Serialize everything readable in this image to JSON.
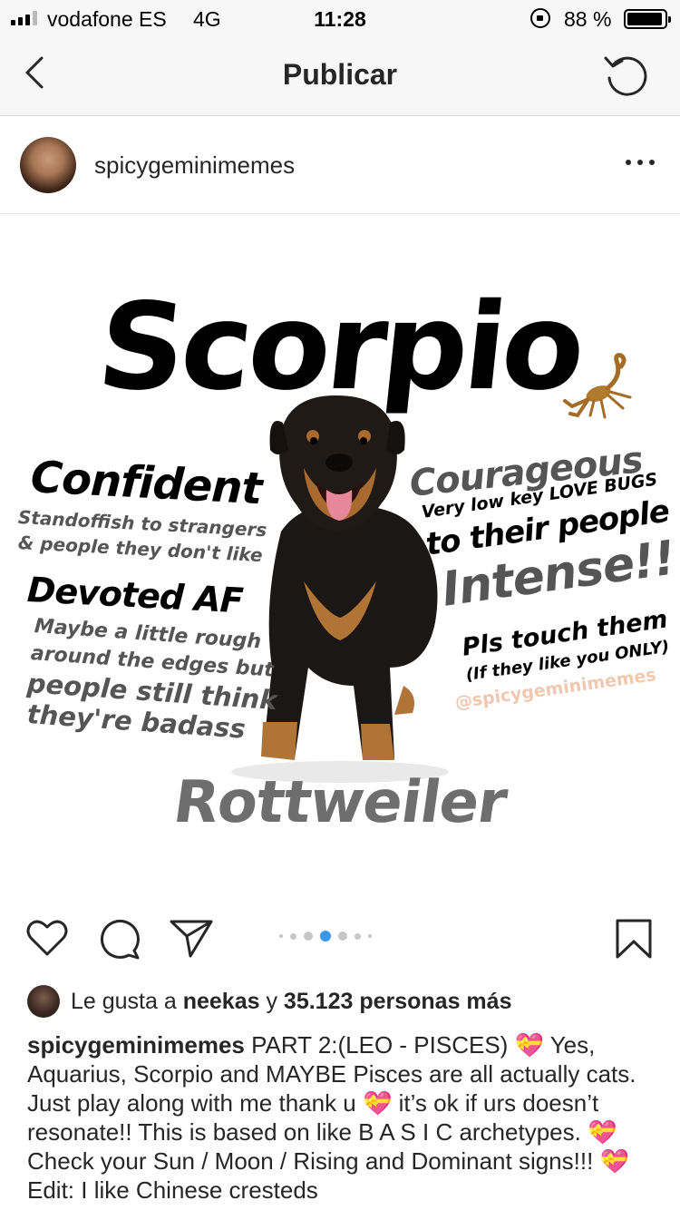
{
  "status_bar": {
    "carrier": "vodafone ES",
    "network": "4G",
    "time": "11:28",
    "battery_percent": "88 %",
    "signal_bars_filled": 3,
    "signal_bars_total": 4,
    "icons": [
      "signal-icon",
      "orientation-lock-icon",
      "battery-icon"
    ]
  },
  "nav": {
    "title": "Publicar",
    "back_icon": "chevron-left-icon",
    "refresh_icon": "refresh-icon"
  },
  "post": {
    "username": "spicygeminimemes",
    "more_icon": "more-horizontal-icon",
    "image": {
      "title": "Scorpio",
      "breed": "Rottweiler",
      "left_traits": {
        "confident": "Confident",
        "standoffish_1": "Standoffish to strangers",
        "standoffish_2": "& people they don't like",
        "devoted": "Devoted AF",
        "maybe_1": "Maybe a little rough",
        "maybe_2": "around the edges but",
        "people_1": "people still think",
        "people_2": "they're badass"
      },
      "right_traits": {
        "courageous": "Courageous",
        "lowkey": "Very low key LOVE BUGS",
        "to_their": "to their people",
        "intense": "Intense!!",
        "pls": "Pls touch them",
        "if_like": "(If they like you ONLY)",
        "handle": "@spicygeminimemes"
      }
    },
    "carousel": {
      "count": 7,
      "active_index": 3,
      "active_color": "#3897f0"
    },
    "likes": {
      "prefix": "Le gusta a",
      "user": "neekas",
      "joiner": "y",
      "count_text": "35.123 personas más"
    },
    "caption": {
      "username": "spicygeminimemes",
      "part1": "PART 2:(LEO - PISCES)",
      "part2": "Yes, Aquarius, Scorpio and MAYBE Pisces are all actually cats. Just play along with me thank u",
      "part3": "it’s ok if urs doesn’t resonate!! This is based on like B A S I C archetypes.",
      "part4": "Check your Sun / Moon / Rising and Dominant signs!!!",
      "part5": "Edit:  I like Chinese cresteds",
      "emoji": "💝"
    }
  }
}
